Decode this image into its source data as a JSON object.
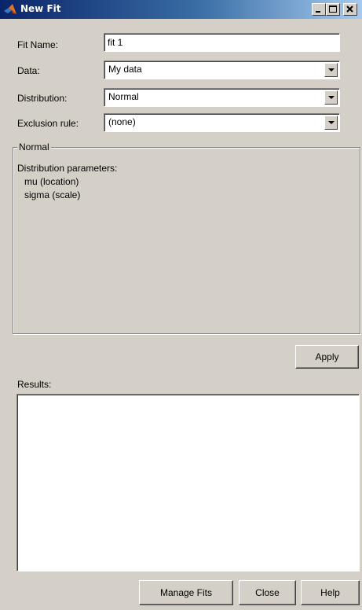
{
  "window": {
    "title": "New Fit",
    "minimize": "_",
    "maximize": "□",
    "close": "×"
  },
  "form": {
    "fit_name_label": "Fit Name:",
    "fit_name_value": "fit 1",
    "data_label": "Data:",
    "data_value": "My data",
    "distribution_label": "Distribution:",
    "distribution_value": "Normal",
    "exclusion_label": "Exclusion rule:",
    "exclusion_value": "(none)"
  },
  "group": {
    "title": "Normal",
    "params_heading": "Distribution parameters:",
    "params": [
      "mu (location)",
      "sigma (scale)"
    ]
  },
  "buttons": {
    "apply": "Apply",
    "manage_fits": "Manage Fits",
    "close": "Close",
    "help": "Help"
  },
  "results": {
    "label": "Results:"
  },
  "colors": {
    "title_start": "#0a246a",
    "title_end": "#a6caf0",
    "face": "#d4d0c8"
  }
}
